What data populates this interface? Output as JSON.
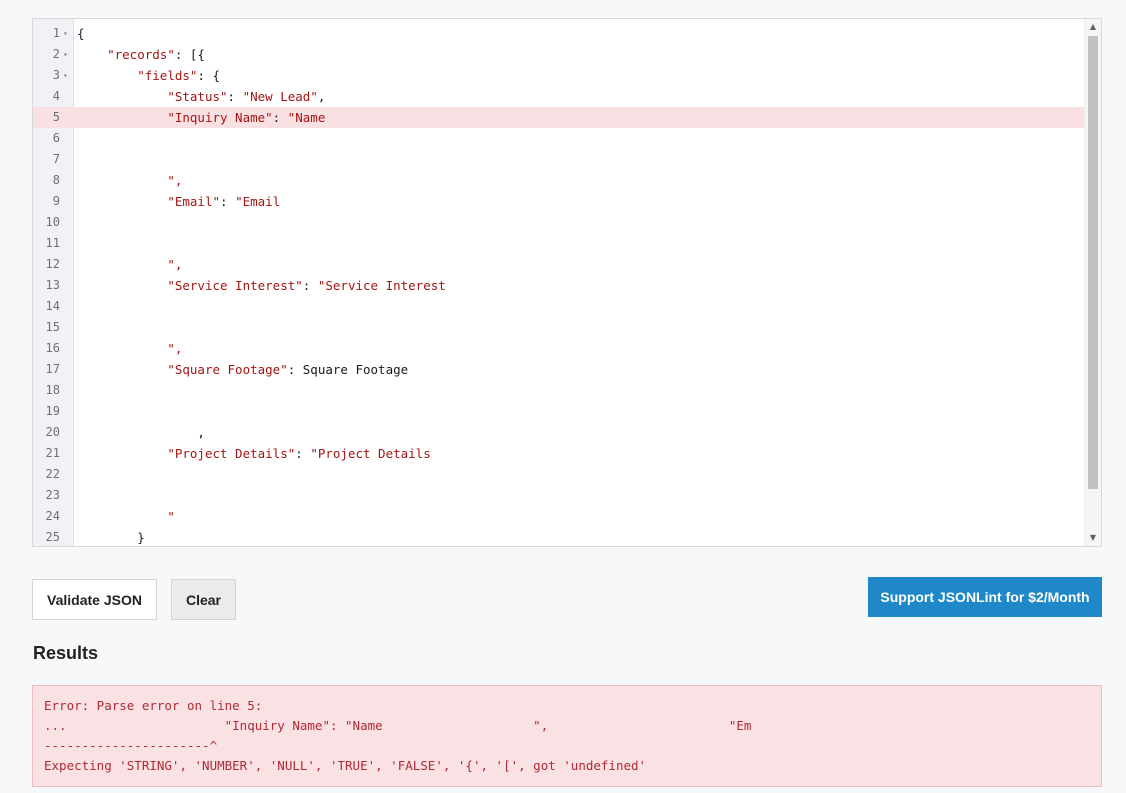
{
  "editor": {
    "lines": [
      {
        "num": "1",
        "fold": "▾",
        "text": "{",
        "error": false
      },
      {
        "num": "2",
        "fold": "▾",
        "text": "    \"records\": [{",
        "error": false
      },
      {
        "num": "3",
        "fold": "▾",
        "text": "        \"fields\": {",
        "error": false
      },
      {
        "num": "4",
        "fold": "",
        "text": "            \"Status\": \"New Lead\",",
        "error": false
      },
      {
        "num": "5",
        "fold": "",
        "text": "            \"Inquiry Name\": \"Name",
        "error": true
      },
      {
        "num": "6",
        "fold": "",
        "text": "",
        "error": false
      },
      {
        "num": "7",
        "fold": "",
        "text": "",
        "error": false
      },
      {
        "num": "8",
        "fold": "",
        "text": "            \",",
        "error": false
      },
      {
        "num": "9",
        "fold": "",
        "text": "            \"Email\": \"Email",
        "error": false
      },
      {
        "num": "10",
        "fold": "",
        "text": "",
        "error": false
      },
      {
        "num": "11",
        "fold": "",
        "text": "",
        "error": false
      },
      {
        "num": "12",
        "fold": "",
        "text": "            \",",
        "error": false
      },
      {
        "num": "13",
        "fold": "",
        "text": "            \"Service Interest\": \"Service Interest",
        "error": false
      },
      {
        "num": "14",
        "fold": "",
        "text": "",
        "error": false
      },
      {
        "num": "15",
        "fold": "",
        "text": "",
        "error": false
      },
      {
        "num": "16",
        "fold": "",
        "text": "            \",",
        "error": false
      },
      {
        "num": "17",
        "fold": "",
        "text": "            \"Square Footage\": Square Footage",
        "error": false
      },
      {
        "num": "18",
        "fold": "",
        "text": "",
        "error": false
      },
      {
        "num": "19",
        "fold": "",
        "text": "",
        "error": false
      },
      {
        "num": "20",
        "fold": "",
        "text": "                ,",
        "error": false
      },
      {
        "num": "21",
        "fold": "",
        "text": "            \"Project Details\": \"Project Details",
        "error": false
      },
      {
        "num": "22",
        "fold": "",
        "text": "",
        "error": false
      },
      {
        "num": "23",
        "fold": "",
        "text": "",
        "error": false
      },
      {
        "num": "24",
        "fold": "",
        "text": "            \"",
        "error": false
      },
      {
        "num": "25",
        "fold": "",
        "text": "        }",
        "error": false
      }
    ],
    "scroll_up_icon": "▲",
    "scroll_down_icon": "▼"
  },
  "buttons": {
    "validate": "Validate JSON",
    "clear": "Clear",
    "support": "Support JSONLint for $2/Month"
  },
  "results": {
    "title": "Results",
    "lines": [
      "Error: Parse error on line 5:",
      "...                     \"Inquiry Name\": \"Name                    \",                        \"Em",
      "----------------------^",
      "Expecting 'STRING', 'NUMBER', 'NULL', 'TRUE', 'FALSE', '{', '[', got 'undefined'"
    ]
  },
  "colors": {
    "support_button": "#1e88c8",
    "error_background": "#fae1e3",
    "error_text": "#b02a37",
    "string_color": "#a31515"
  }
}
